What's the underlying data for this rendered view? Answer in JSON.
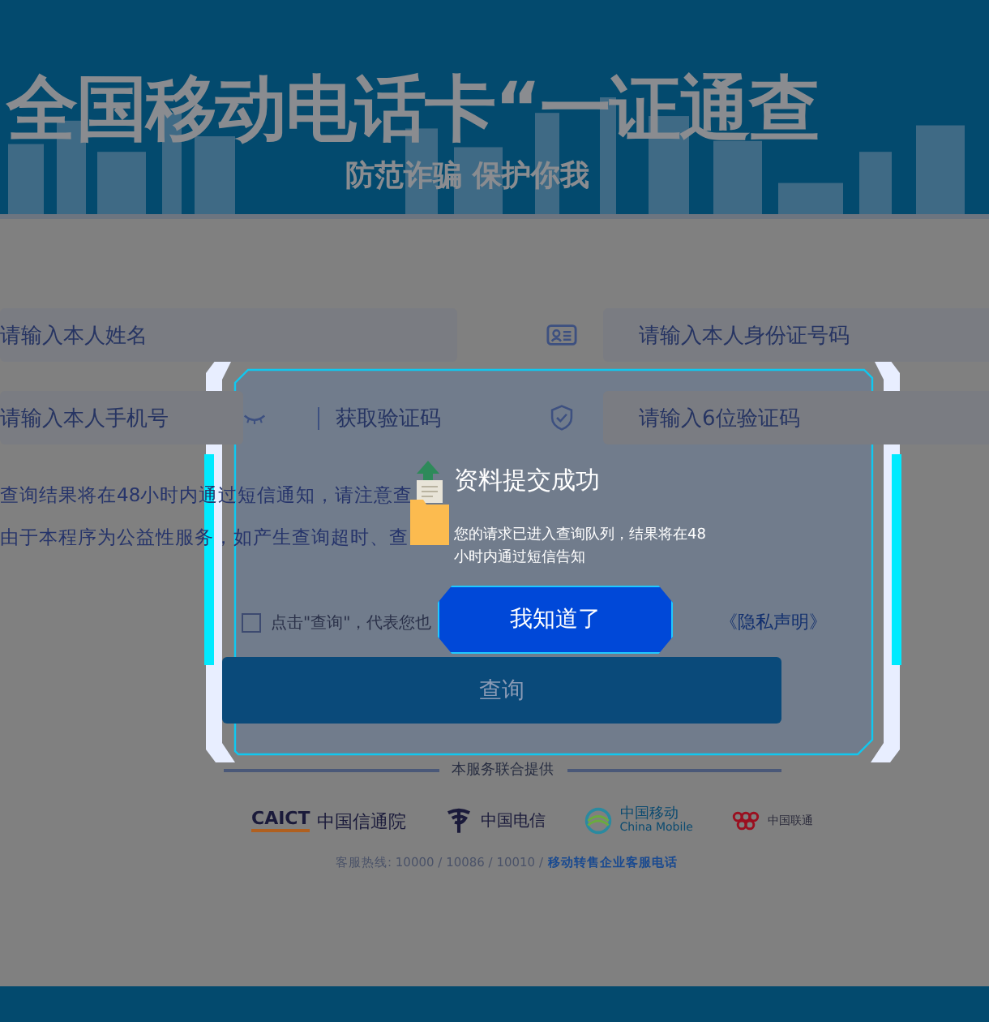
{
  "banner": {
    "title": "全国移动电话卡“一证通查",
    "subtitle": "防范诈骗 保护你我"
  },
  "form": {
    "rows": [
      {
        "left": {
          "placeholder": "请输入本人姓名"
        },
        "right": {
          "placeholder": "请输入本人身份证号码"
        }
      },
      {
        "left": {
          "placeholder": "请输入本人手机号",
          "action": "获取验证码"
        },
        "right": {
          "placeholder": "请输入6位验证码"
        }
      }
    ]
  },
  "notices": [
    "查询结果将在48小时内通过短信通知，请注意查",
    "由于本程序为公益性服务，如产生查询超时、查"
  ],
  "agreement": {
    "checked": false,
    "text": "点击\"查询\"，代表您也",
    "link": "《隐私声明》"
  },
  "submit": "查询",
  "footer": {
    "provided_by": "本服务联合提供",
    "partners": [
      {
        "kind": "caict",
        "mark": "CAICT",
        "name": "中国信通院"
      },
      {
        "kind": "telecom",
        "name": "中国电信"
      },
      {
        "kind": "mobile",
        "name": "中国移动",
        "english": "China Mobile"
      },
      {
        "kind": "unicom",
        "name": "中国联通"
      }
    ],
    "hotline": "客服热线: 10000 / 10086 / 10010 /",
    "hotline_link": "移动转售企业客服电话"
  },
  "dialog": {
    "title": "资料提交成功",
    "message": "您的请求已进入查询队列，结果将在48小时内通过短信告知",
    "button": "我知道了"
  }
}
